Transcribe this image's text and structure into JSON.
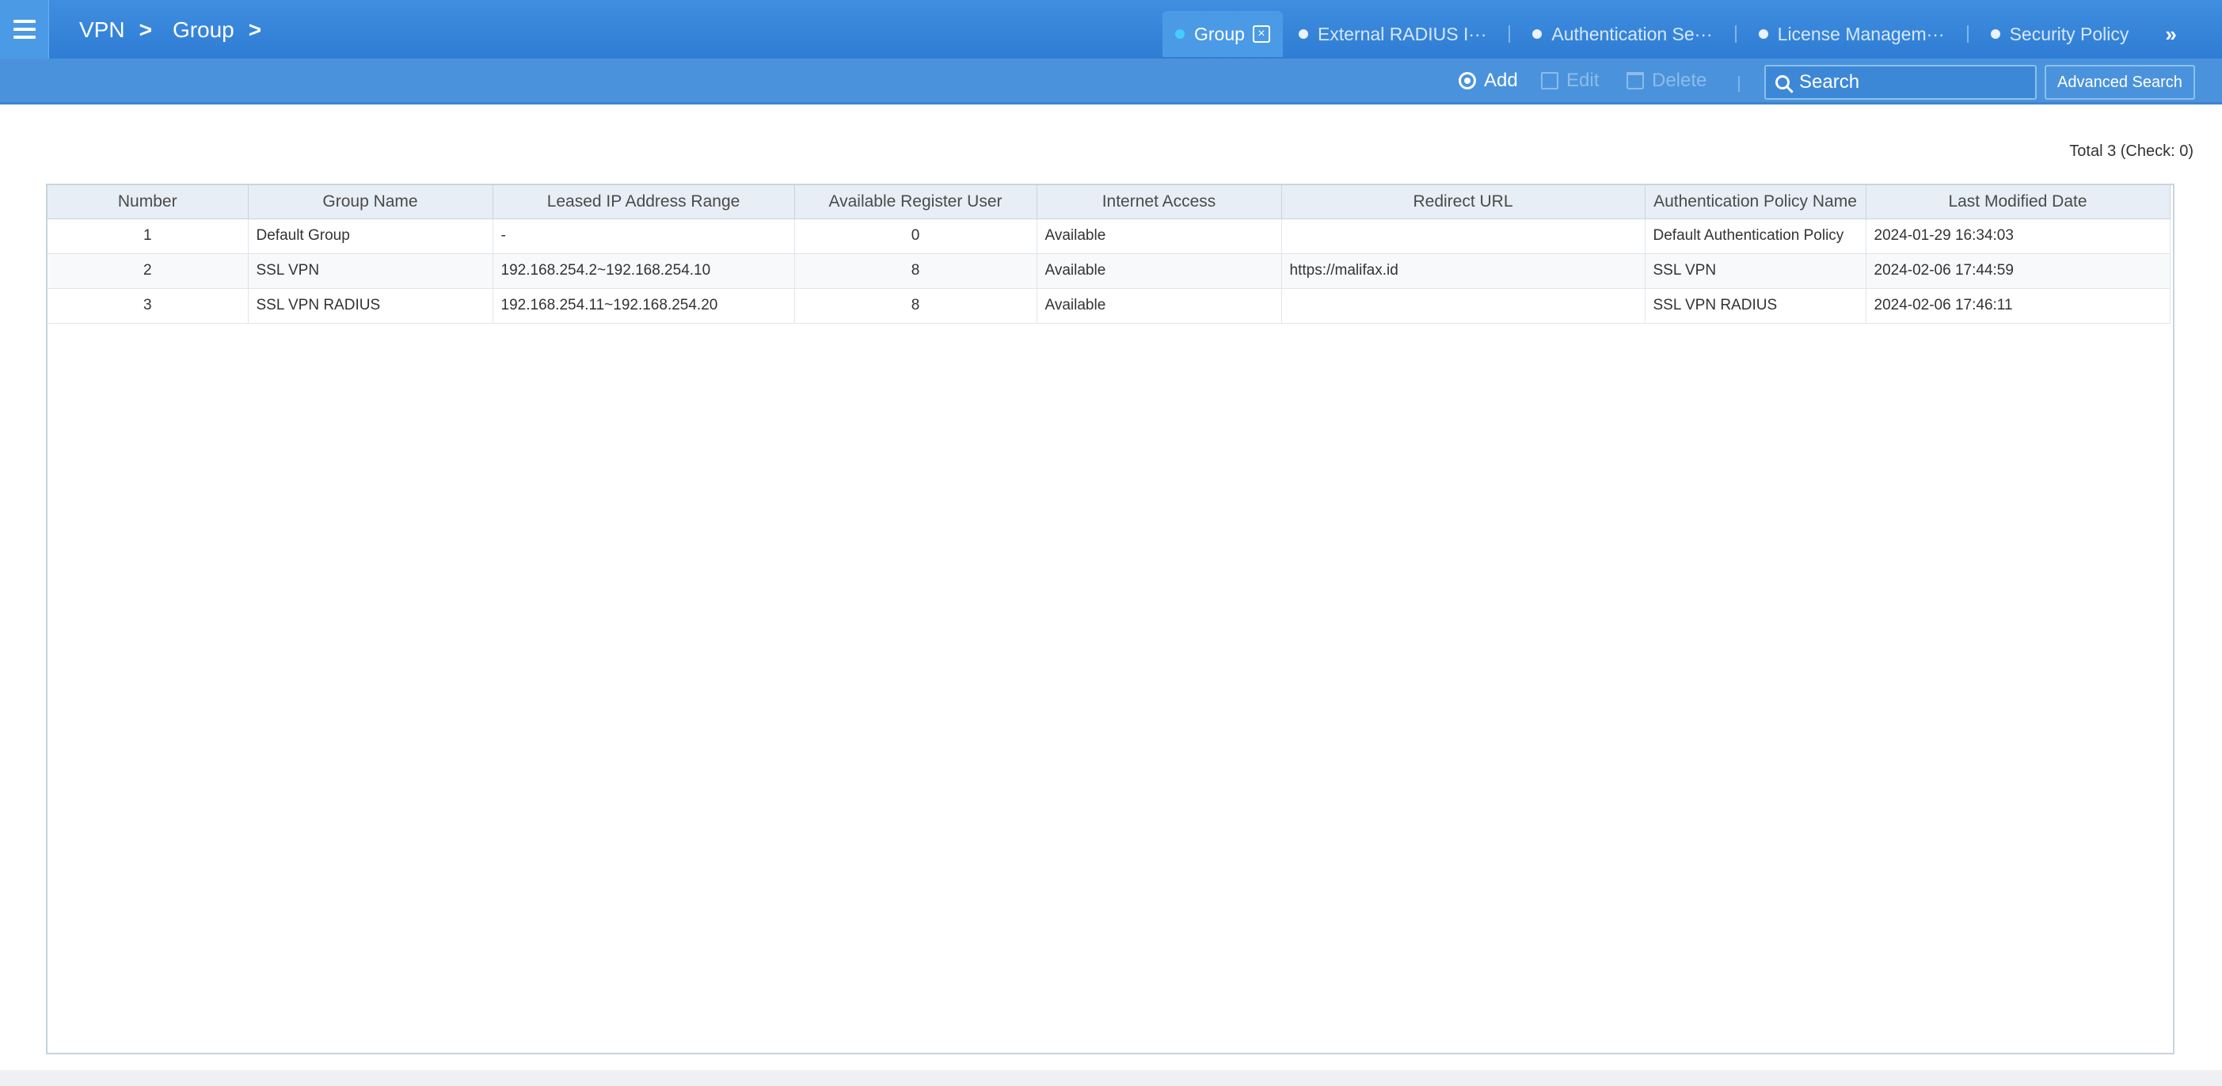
{
  "breadcrumb": [
    "VPN",
    "Group"
  ],
  "breadcrumb_sep": ">",
  "tabs": [
    {
      "label": "Group",
      "active": true
    },
    {
      "label": "External RADIUS I···",
      "active": false
    },
    {
      "label": "Authentication Se···",
      "active": false
    },
    {
      "label": "License Managem···",
      "active": false
    },
    {
      "label": "Security Policy",
      "active": false
    }
  ],
  "tab_close_glyph": "×",
  "tab_more": "»",
  "toolbar": {
    "add_label": "Add",
    "edit_label": "Edit",
    "delete_label": "Delete",
    "search_placeholder": "Search",
    "advanced_search_label": "Advanced Search"
  },
  "total_text": "Total 3 (Check: 0)",
  "table": {
    "columns": [
      "Number",
      "Group Name",
      "Leased IP Address Range",
      "Available Register User",
      "Internet Access",
      "Redirect URL",
      "Authentication Policy Name",
      "Last Modified Date"
    ],
    "rows": [
      [
        "1",
        "Default Group",
        "-",
        "0",
        "Available",
        "",
        "Default Authentication Policy",
        "2024-01-29 16:34:03"
      ],
      [
        "2",
        "SSL VPN",
        "192.168.254.2~192.168.254.10",
        "8",
        "Available",
        "https://malifax.id",
        "SSL VPN",
        "2024-02-06 17:44:59"
      ],
      [
        "3",
        "SSL VPN RADIUS",
        "192.168.254.11~192.168.254.20",
        "8",
        "Available",
        "",
        "SSL VPN RADIUS",
        "2024-02-06 17:46:11"
      ]
    ]
  },
  "icons": {
    "menu": "hamburger-menu-icon",
    "add": "add-circle-icon",
    "edit": "edit-icon",
    "delete": "trash-icon",
    "search": "search-icon",
    "tab_close": "close-icon"
  },
  "colors": {
    "header_blue": "#2f7dd4",
    "toolbar_blue": "#4a93dc",
    "active_tab": "#4b9ae6",
    "active_dot": "#45d3ff"
  }
}
